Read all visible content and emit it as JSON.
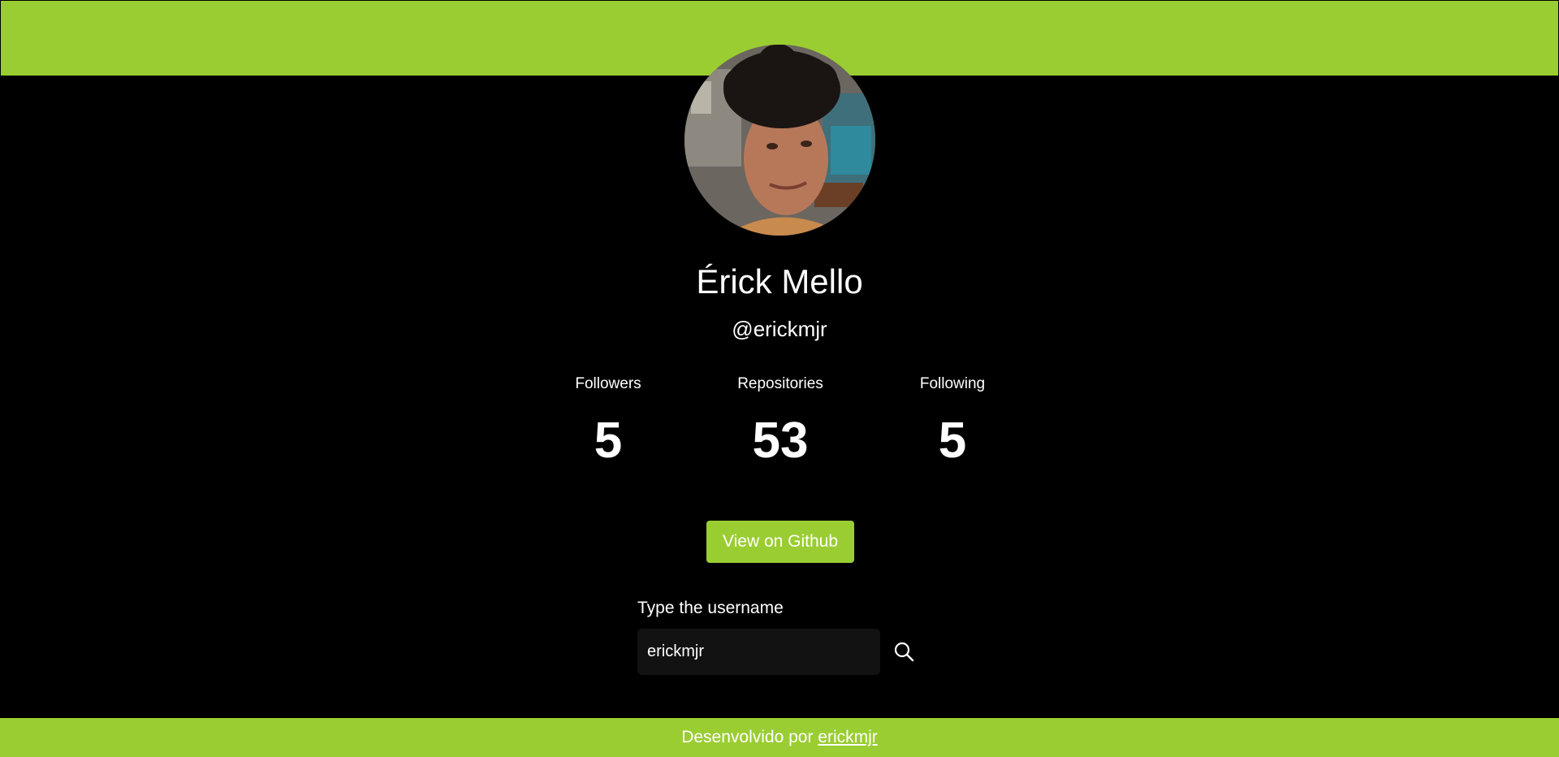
{
  "profile": {
    "name": "Érick Mello",
    "handle": "@erickmjr"
  },
  "stats": {
    "followers_label": "Followers",
    "followers_value": "5",
    "repositories_label": "Repositories",
    "repositories_value": "53",
    "following_label": "Following",
    "following_value": "5"
  },
  "github_button": {
    "label": "View on Github"
  },
  "search": {
    "label": "Type the username",
    "value": "erickmjr",
    "icon": "search-icon"
  },
  "footer": {
    "text": "Desenvolvido por ",
    "link_text": "erickmjr"
  },
  "colors": {
    "accent": "#9acd32",
    "background": "#000000",
    "input_background": "#121212",
    "text": "#ffffff"
  }
}
